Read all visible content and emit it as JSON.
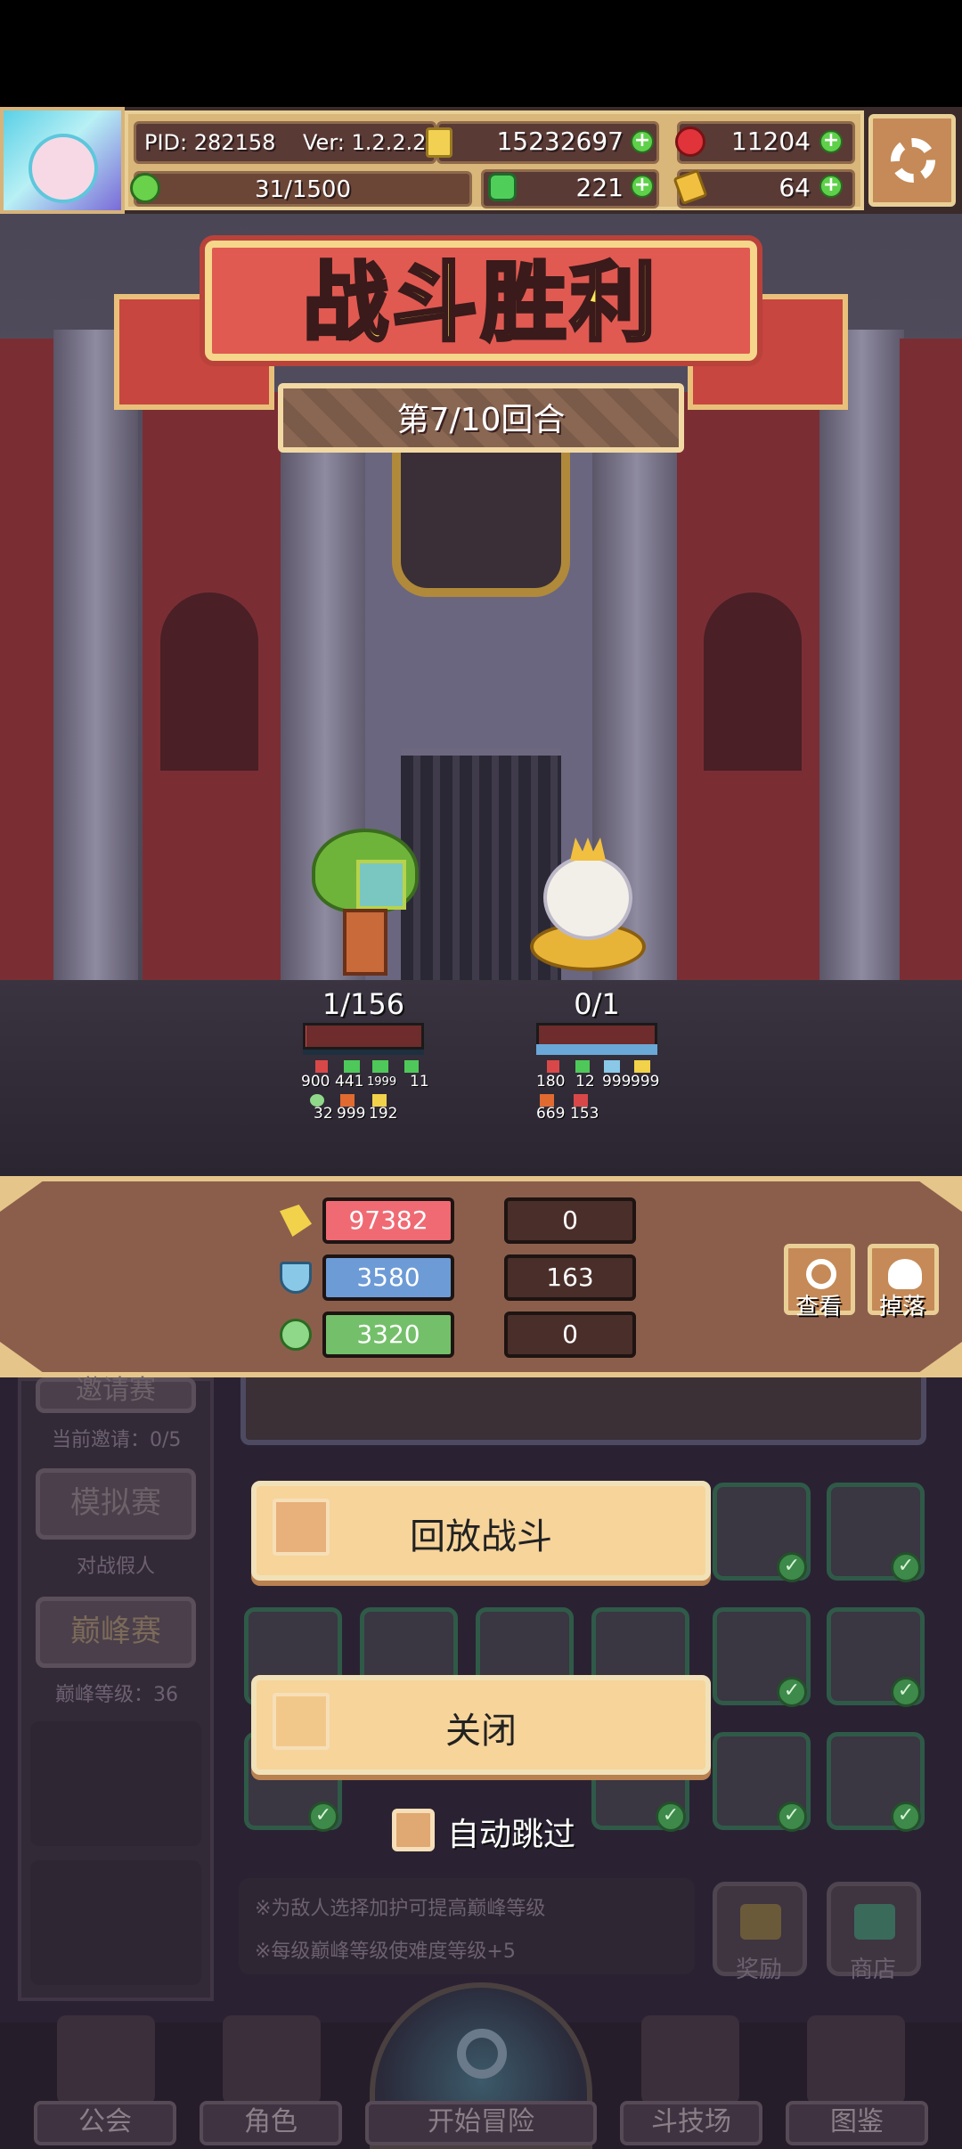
{
  "header": {
    "pid": "PID: 282158",
    "version": "Ver: 1.2.2.2",
    "gold": "15232697",
    "gems": "11204",
    "energy": "31/1500",
    "clover": "221",
    "keys": "64"
  },
  "battle": {
    "title": "战斗胜利",
    "round": "第7/10回合",
    "ally": {
      "hp_text": "1/156",
      "hp_fraction": 0.0064,
      "stats_row1": [
        "900",
        "441",
        "1999",
        "11"
      ],
      "stats_row2": [
        "32",
        "999",
        "192"
      ]
    },
    "enemy": {
      "hp_text": "0/1",
      "hp_fraction": 0,
      "stats_row1": [
        "180",
        "12",
        "999",
        "999"
      ],
      "stats_row2": [
        "669",
        "153"
      ]
    }
  },
  "results": {
    "damage": [
      "97382",
      "0"
    ],
    "defense": [
      "3580",
      "163"
    ],
    "heal": [
      "3320",
      "0"
    ],
    "view_label": "查看",
    "drop_label": "掉落"
  },
  "background": {
    "invite_label": "邀请赛",
    "invite_status": "当前邀请：0/5",
    "sim_label": "模拟赛",
    "sim_sub": "对战假人",
    "peak_label": "巅峰赛",
    "peak_level": "巅峰等级：36",
    "hint1": "※为敌人选择加护可提高巅峰等级",
    "hint2": "※每级巅峰等级使难度等级+5",
    "reward_label": "奖励",
    "shop_label": "商店"
  },
  "dialog": {
    "replay_label": "回放战斗",
    "close_label": "关闭",
    "autoskip_label": "自动跳过"
  },
  "nav": {
    "guild": "公会",
    "character": "角色",
    "adventure": "开始冒险",
    "arena": "斗技场",
    "codex": "图鉴"
  },
  "colors": {
    "title_yellow": "#fbe857",
    "banner_red": "#e05a52",
    "panel_brown": "#8b5e4c",
    "button_cream": "#f7d49a"
  }
}
